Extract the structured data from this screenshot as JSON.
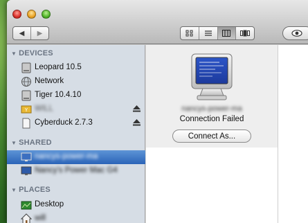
{
  "toolbar": {
    "back_glyph": "◀",
    "forward_glyph": "▶",
    "view_modes": [
      "icon-view",
      "list-view",
      "column-view",
      "coverflow-view"
    ],
    "active_view": "column-view"
  },
  "sidebar": {
    "devices_header": "DEVICES",
    "shared_header": "SHARED",
    "places_header": "PLACES",
    "devices": [
      {
        "label": "Leopard 10.5",
        "icon": "hard-drive-icon",
        "eject": false,
        "obscured": false
      },
      {
        "label": "Network",
        "icon": "network-globe-icon",
        "eject": false,
        "obscured": false
      },
      {
        "label": "Tiger 10.4.10",
        "icon": "hard-drive-icon",
        "eject": false,
        "obscured": false
      },
      {
        "label": "WILL",
        "icon": "usb-drive-icon",
        "eject": true,
        "obscured": true
      },
      {
        "label": "Cyberduck 2.7.3",
        "icon": "disk-image-icon",
        "eject": true,
        "obscured": false
      }
    ],
    "shared": [
      {
        "label": "nancys-power-ma",
        "icon": "monitor-icon",
        "selected": true,
        "obscured": true
      },
      {
        "label": "Nancy's Power Mac G4",
        "icon": "monitor-icon",
        "selected": false,
        "obscured": true
      }
    ],
    "places": [
      {
        "label": "Desktop",
        "icon": "desktop-folder-icon",
        "obscured": false
      },
      {
        "label": "will",
        "icon": "home-icon",
        "obscured": true
      }
    ]
  },
  "main": {
    "server_name": "nancys-power-ma",
    "status": "Connection Failed",
    "connect_button": "Connect As..."
  },
  "colors": {
    "selection": "#2b64b8",
    "sidebar_bg": "#d6dde5",
    "header_text": "#6a7482"
  }
}
